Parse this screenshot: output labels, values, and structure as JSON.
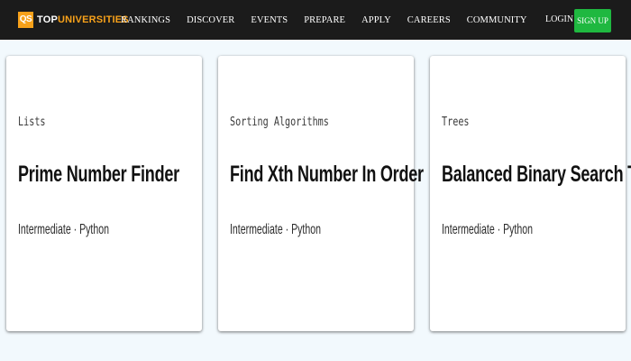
{
  "header": {
    "logo_badge": "QS",
    "logo_brand": "TOP",
    "logo_accent": "UNIVERSITIES",
    "nav_items": [
      {
        "label": "RANKINGS"
      },
      {
        "label": "DISCOVER"
      },
      {
        "label": "EVENTS"
      },
      {
        "label": "PREPARE"
      },
      {
        "label": "APPLY"
      },
      {
        "label": "CAREERS"
      },
      {
        "label": "COMMUNITY"
      }
    ],
    "login_label": "LOGIN",
    "signup_label": "SIGN UP"
  },
  "cards": [
    {
      "category": "Lists",
      "title": "Prime Number Finder",
      "meta": "Intermediate · Python"
    },
    {
      "category": "Sorting Algorithms",
      "title": "Find Xth Number In Order",
      "meta": "Intermediate · Python"
    },
    {
      "category": "Trees",
      "title": "Balanced Binary Search Tree",
      "meta": "Intermediate · Python"
    }
  ],
  "colors": {
    "header_bg": "#1b1b1b",
    "brand_accent": "#f7a11a",
    "signup_green": "#1fb840",
    "page_bg": "#f2f9fd"
  }
}
